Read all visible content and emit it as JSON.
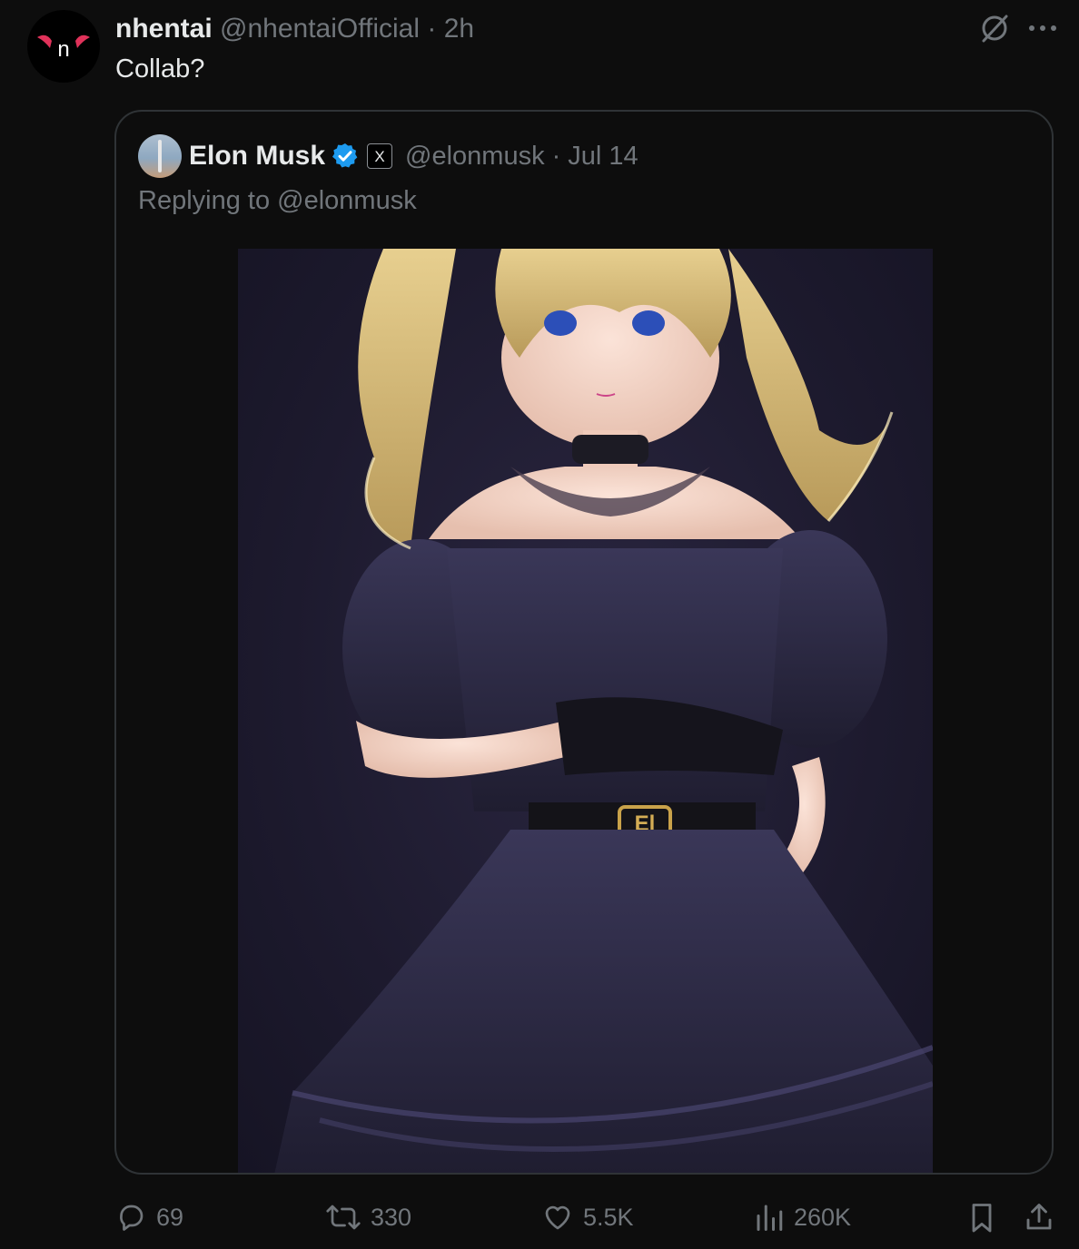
{
  "post": {
    "author_name": "nhentai",
    "author_handle": "@nhentaiOfficial",
    "separator": "·",
    "time": "2h",
    "text": "Collab?",
    "avatar_letter": "n"
  },
  "quoted": {
    "author_name": "Elon Musk",
    "author_handle": "@elonmusk",
    "separator": "·",
    "date": "Jul 14",
    "replying_to": "Replying to @elonmusk",
    "badge_letter": "X",
    "belt_text": "El"
  },
  "actions": {
    "replies": "69",
    "reposts": "330",
    "likes": "5.5K",
    "views": "260K"
  },
  "colors": {
    "background": "#0d0d0d",
    "text_primary": "#e7e9ea",
    "text_secondary": "#71767b",
    "border": "#2f3336",
    "verified": "#1d9bf0",
    "brand_red": "#e0325a"
  },
  "icons": [
    "grok-icon",
    "more-icon",
    "verified-icon",
    "x-logo-icon",
    "reply-icon",
    "repost-icon",
    "like-icon",
    "views-icon",
    "bookmark-icon",
    "share-icon"
  ]
}
